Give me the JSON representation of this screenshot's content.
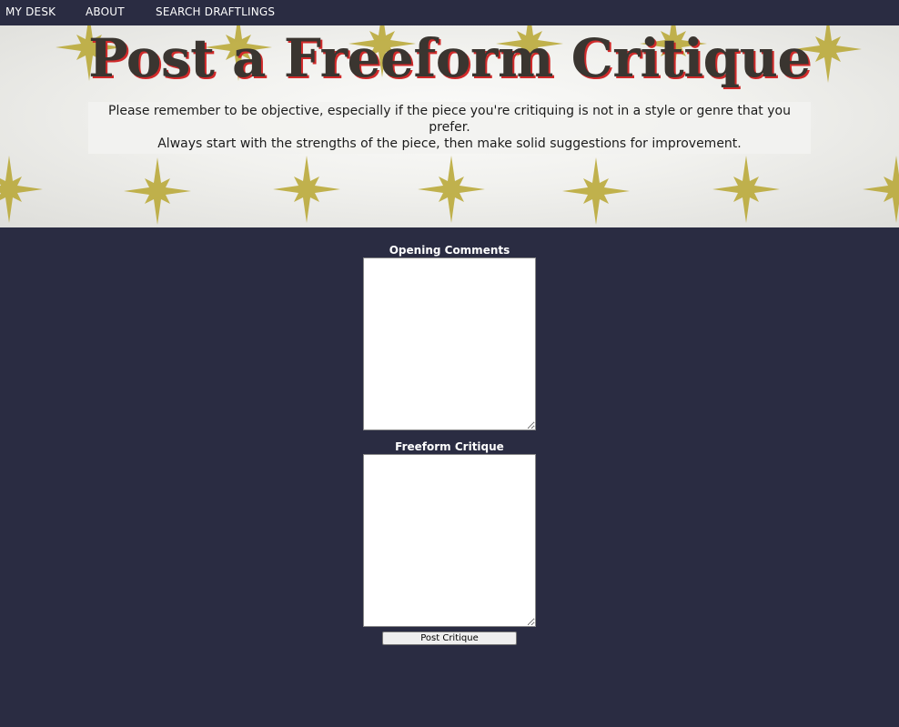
{
  "nav": {
    "items": [
      {
        "label": "MY DESK"
      },
      {
        "label": "ABOUT"
      },
      {
        "label": "SEARCH DRAFTLINGS"
      }
    ]
  },
  "banner": {
    "title": "Post a Freeform Critique",
    "note_line1": "Please remember to be objective, especially if the piece you're critiquing is not in a style or genre that you prefer.",
    "note_line2": "Always start with the strengths of the piece, then make solid suggestions for improvement.",
    "decoration_icon": "star-icon",
    "star_color": "#b8a630"
  },
  "form": {
    "opening_label": "Opening Comments",
    "opening_value": "",
    "freeform_label": "Freeform Critique",
    "freeform_value": "",
    "submit_label": "Post Critique"
  },
  "colors": {
    "background": "#2a2c42",
    "title_shadow": "#d12a2a",
    "title_text": "#3a3530"
  }
}
